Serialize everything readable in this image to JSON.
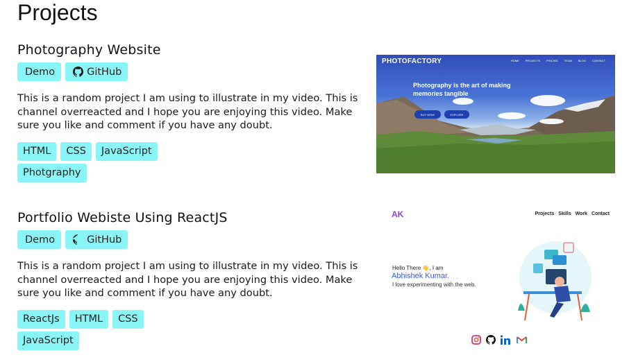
{
  "page": {
    "title": "Projects"
  },
  "projects": [
    {
      "title": "Photography Website",
      "demo_label": "Demo",
      "github_label": "GitHub",
      "description": "This is a random project I am using to illustrate in my video. This is channel overreacted and I hope you are enjoying this video. Make sure you like and comment if you have any doubt.",
      "tags": [
        "HTML",
        "CSS",
        "JavaScript",
        "Photgraphy"
      ],
      "preview": {
        "brand": "PHOTOFACTORY",
        "nav": [
          "HOME",
          "PROJECTS",
          "PRICING",
          "TEAM",
          "BLOG",
          "CONTACT"
        ],
        "headline": "Photography is the art of making memories tangible",
        "buy_label": "BUY NOW!",
        "explore_label": "EXPLORE"
      }
    },
    {
      "title": "Portfolio Webiste Using ReactJS",
      "demo_label": "Demo",
      "github_label": "GitHub",
      "description": "This is a random project I am using to illustrate in my video. This is channel overreacted and I hope you are enjoying this video. Make sure you like and comment if you have any doubt.",
      "tags": [
        "ReactJs",
        "HTML",
        "CSS",
        "JavaScript"
      ],
      "preview": {
        "logo": "AK",
        "nav": [
          "Projects",
          "Skills",
          "Work",
          "Contact"
        ],
        "hello": "Hello There 👋, I am",
        "name": "Abhishek Kumar.",
        "tagline": "I love experimenting with the web.",
        "socials": [
          "instagram-icon",
          "github-icon",
          "linkedin-icon",
          "gmail-icon"
        ]
      }
    }
  ],
  "colors": {
    "chip_bg": "#8af5f7",
    "accent_purple": "#8b3fd9",
    "accent_blue": "#3b5bd9"
  }
}
